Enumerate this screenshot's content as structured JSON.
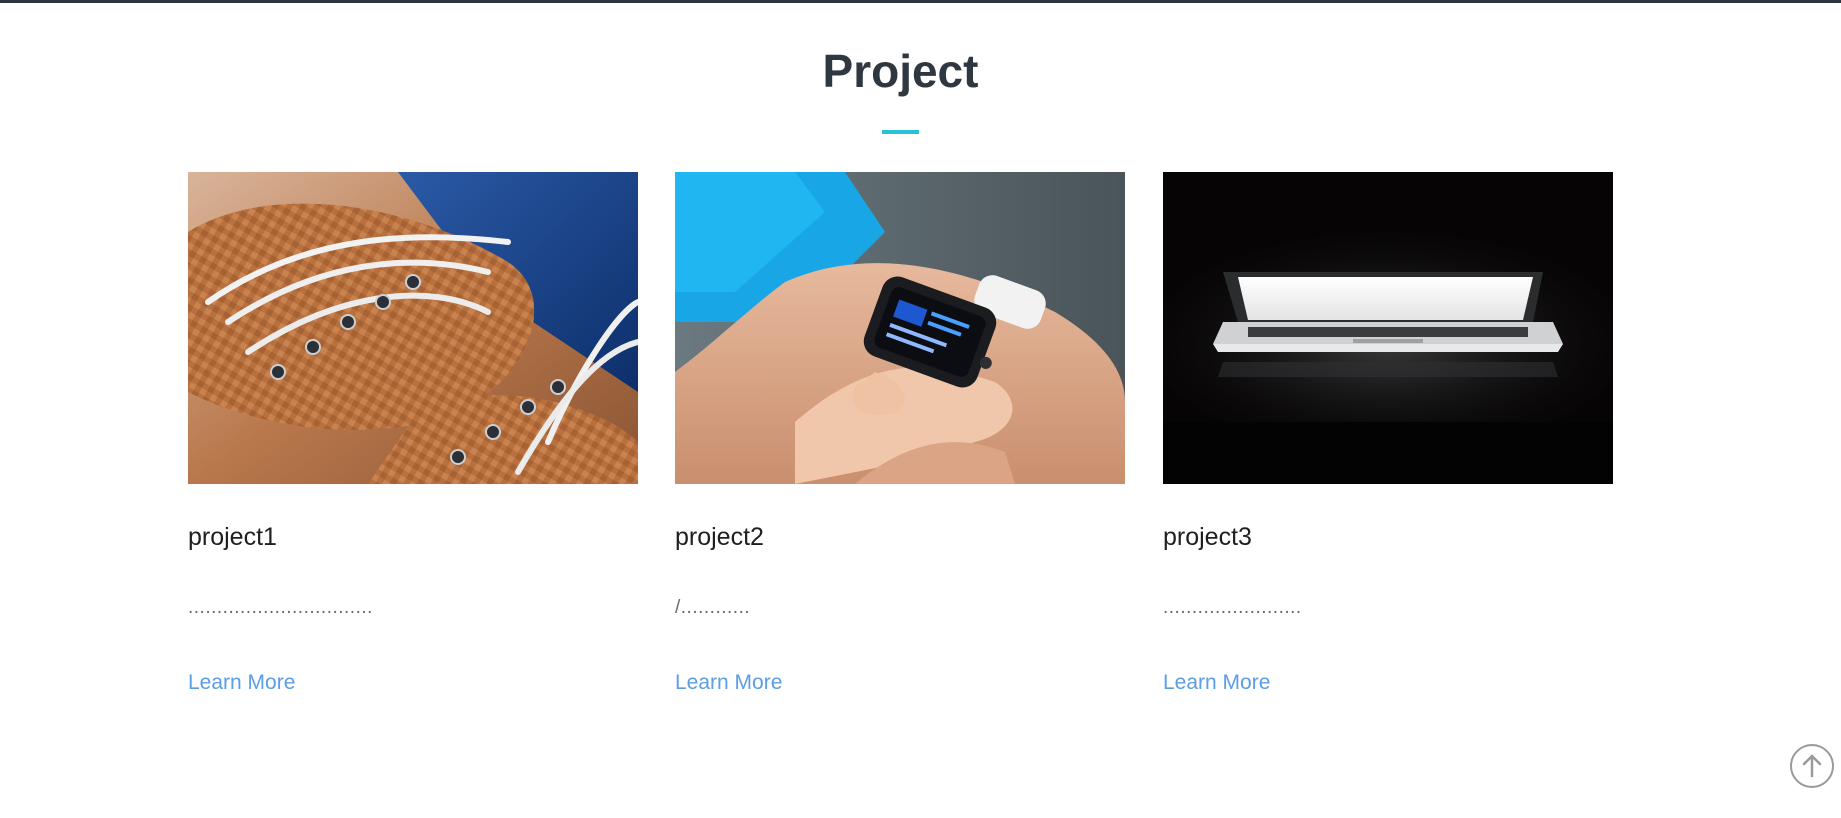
{
  "section": {
    "title": "Project"
  },
  "accent_color": "#27c1d9",
  "link_color": "#5b9ee6",
  "projects": [
    {
      "title": "project1",
      "description": "................................",
      "link_label": "Learn More",
      "image": "leather-shoes-photo"
    },
    {
      "title": "project2",
      "description": "/............",
      "link_label": "Learn More",
      "image": "smartwatch-wrist-photo"
    },
    {
      "title": "project3",
      "description": "........................",
      "link_label": "Learn More",
      "image": "laptop-dark-photo"
    }
  ],
  "scroll_top": {
    "icon": "arrow-up-icon"
  }
}
